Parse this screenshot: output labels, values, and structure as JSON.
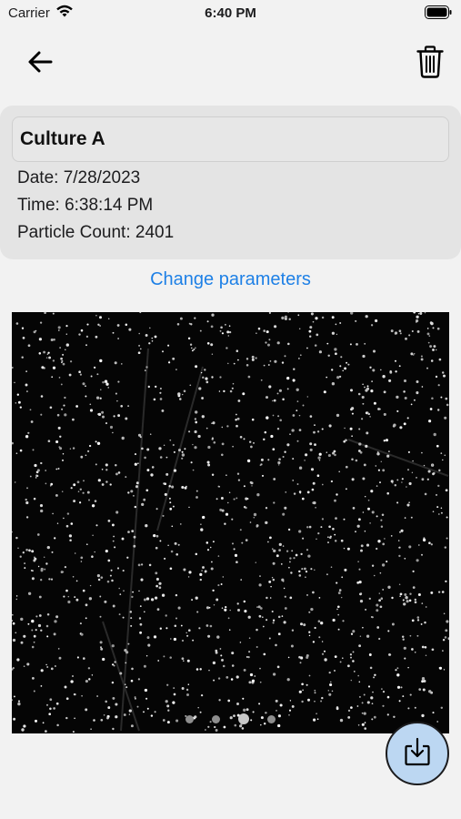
{
  "status_bar": {
    "carrier": "Carrier",
    "time": "6:40 PM"
  },
  "nav": {
    "back_icon": "arrow-left-icon",
    "delete_icon": "trash-icon"
  },
  "sample": {
    "name": "Culture A",
    "date": "Date: 7/28/2023",
    "time": "Time: 6:38:14 PM",
    "particle_count": "Particle Count: 2401"
  },
  "actions": {
    "change_parameters": "Change parameters",
    "download_icon": "download-icon"
  },
  "gallery": {
    "page_count": 4,
    "current_page": 3
  },
  "colors": {
    "accent": "#1e80e6",
    "fab_background": "#bcd7f2",
    "card_background": "#e4e4e4"
  }
}
